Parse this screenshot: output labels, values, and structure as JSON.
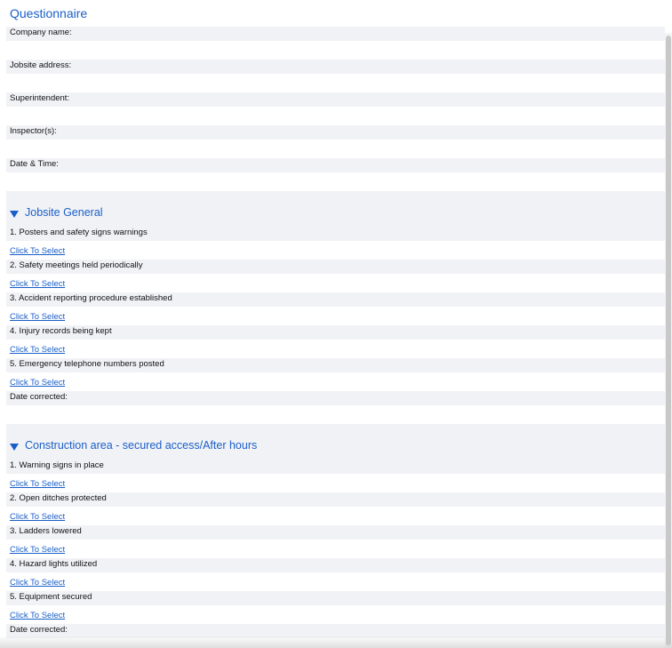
{
  "title": "Questionnaire",
  "fields": [
    {
      "label": "Company name:",
      "value": ""
    },
    {
      "label": "Jobsite address:",
      "value": ""
    },
    {
      "label": "Superintendent:",
      "value": ""
    },
    {
      "label": "Inspector(s):",
      "value": ""
    },
    {
      "label": "Date & Time:",
      "value": ""
    }
  ],
  "sections": [
    {
      "title": "Jobsite General",
      "questions": [
        {
          "label": "1. Posters and safety signs warnings",
          "link": "Click To Select"
        },
        {
          "label": "2. Safety meetings held periodically",
          "link": "Click To Select"
        },
        {
          "label": "3. Accident reporting procedure established",
          "link": "Click To Select"
        },
        {
          "label": "4. Injury records being kept",
          "link": "Click To Select"
        },
        {
          "label": "5. Emergency telephone numbers posted",
          "link": "Click To Select"
        }
      ],
      "date_corrected_label": "Date corrected:"
    },
    {
      "title": "Construction area - secured access/After hours",
      "questions": [
        {
          "label": "1. Warning signs in place",
          "link": "Click To Select"
        },
        {
          "label": "2. Open ditches protected",
          "link": "Click To Select"
        },
        {
          "label": "3. Ladders lowered",
          "link": "Click To Select"
        },
        {
          "label": "4. Hazard lights utilized",
          "link": "Click To Select"
        },
        {
          "label": "5. Equipment secured",
          "link": "Click To Select"
        }
      ],
      "date_corrected_label": "Date corrected:"
    }
  ]
}
